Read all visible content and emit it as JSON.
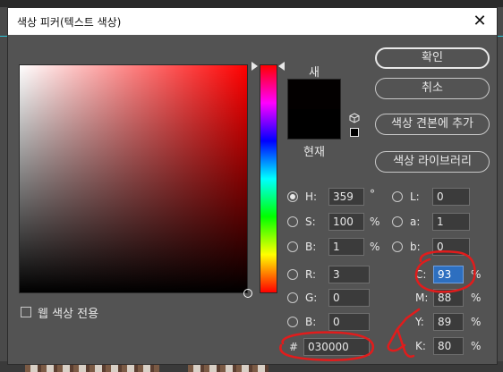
{
  "dialog": {
    "title": "색상 피커(텍스트 색상)",
    "close_glyph": "✕"
  },
  "picker": {
    "hue_degrees": 359,
    "swatch_new_label": "새",
    "swatch_current_label": "현재",
    "new_color": "#030000",
    "current_color": "#000000"
  },
  "buttons": {
    "ok": "확인",
    "cancel": "취소",
    "add_to_swatches": "색상 견본에 추가",
    "color_libraries": "색상 라이브러리"
  },
  "hsb": [
    {
      "key": "h",
      "label": "H:",
      "value": "359",
      "unit": "°",
      "selected": true
    },
    {
      "key": "s",
      "label": "S:",
      "value": "100",
      "unit": "%",
      "selected": false
    },
    {
      "key": "b",
      "label": "B:",
      "value": "1",
      "unit": "%",
      "selected": false
    }
  ],
  "rgb": [
    {
      "key": "r",
      "label": "R:",
      "value": "3"
    },
    {
      "key": "g",
      "label": "G:",
      "value": "0"
    },
    {
      "key": "b",
      "label": "B:",
      "value": "0"
    }
  ],
  "lab": [
    {
      "key": "l",
      "label": "L:",
      "value": "0"
    },
    {
      "key": "a",
      "label": "a:",
      "value": "1"
    },
    {
      "key": "b",
      "label": "b:",
      "value": "0"
    }
  ],
  "cmyk": [
    {
      "key": "c",
      "label": "C:",
      "value": "93",
      "unit": "%",
      "highlighted": true
    },
    {
      "key": "m",
      "label": "M:",
      "value": "88",
      "unit": "%"
    },
    {
      "key": "y",
      "label": "Y:",
      "value": "89",
      "unit": "%"
    },
    {
      "key": "k",
      "label": "K:",
      "value": "80",
      "unit": "%"
    }
  ],
  "hex": {
    "label": "#",
    "value": "030000"
  },
  "web_colors_only": {
    "label": "웹 색상 전용",
    "checked": false
  },
  "colors": {
    "annotation_red": "#e11c1c",
    "selection_blue": "#2d6fc0"
  }
}
